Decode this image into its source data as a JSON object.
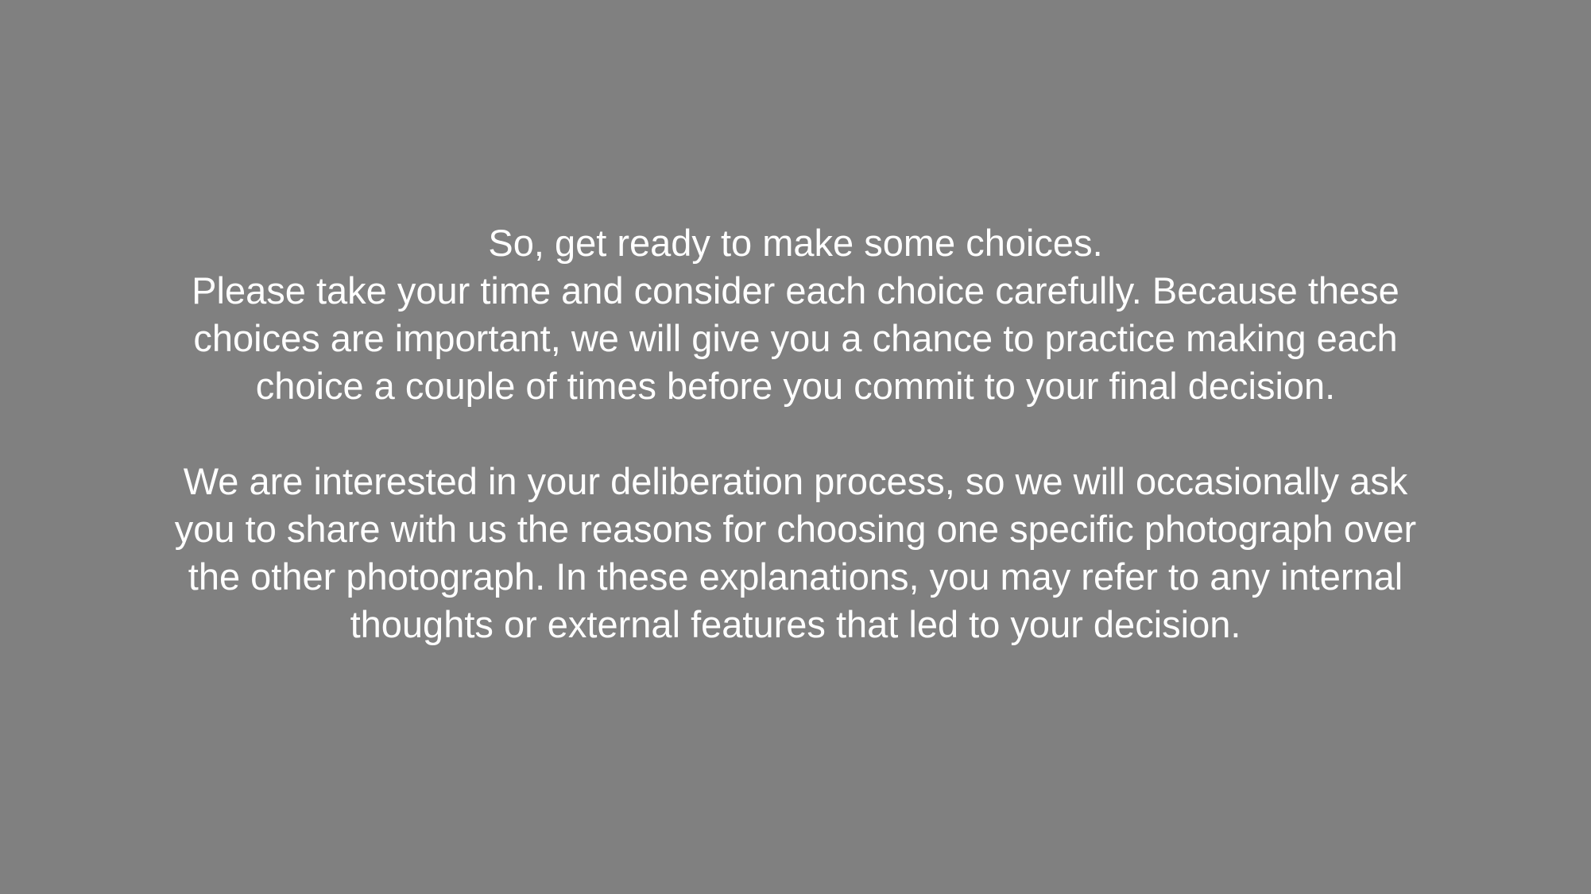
{
  "instructions": {
    "paragraph1": [
      "So, get ready to make some choices.",
      "Please take your time and consider each choice carefully. Because these",
      "choices are important, we will give you a chance to practice making each",
      "choice a couple of times before you commit to your final decision."
    ],
    "paragraph2": [
      "We are interested in your deliberation process, so we will occasionally ask",
      "you to share with us the reasons for choosing one specific photograph over",
      "the other photograph. In these explanations, you may refer to any internal",
      "thoughts or external features that led to your decision."
    ]
  },
  "colors": {
    "background": "#808080",
    "text": "#ffffff"
  }
}
